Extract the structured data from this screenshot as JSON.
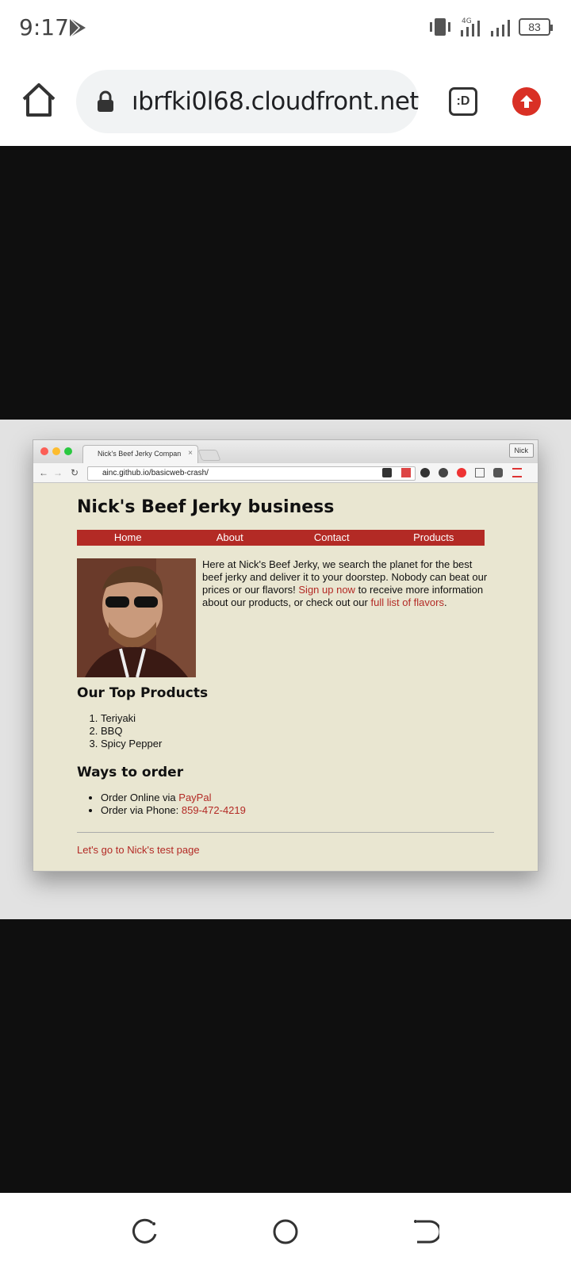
{
  "status_bar": {
    "time": "9:17",
    "battery": "83",
    "network": "4G",
    "icons": [
      "play-store-icon",
      "vibrate-icon",
      "signal-icon",
      "wifi-icon",
      "battery-icon"
    ]
  },
  "browser": {
    "url": "ıbrfki0l68.cloudfront.net",
    "tab_switcher_label": ":D",
    "colors": {
      "upload_button": "#d93025"
    }
  },
  "screenshot": {
    "tab_title": "Nick's Beef Jerky Compan",
    "user_button": "Nick",
    "url": "ainc.github.io/basicweb-crash/",
    "site": {
      "title": "Nick's Beef Jerky business",
      "nav": [
        "Home",
        "About",
        "Contact",
        "Products"
      ],
      "intro": {
        "text1": "Here at Nick's Beef Jerky, we search the planet for the best beef jerky and deliver it to your doorstep. Nobody can beat our prices or our flavors!",
        "link1": "Sign up now",
        "text2": "to receive more information about our products, or check out our",
        "link2": "full list of flavors",
        "text3": "."
      },
      "products_heading": "Our Top Products",
      "products": [
        "Teriyaki",
        "BBQ",
        "Spicy Pepper"
      ],
      "order_heading": "Ways to order",
      "order_online": "Order Online via",
      "order_online_link": "PayPal",
      "order_phone": "Order via Phone:",
      "order_phone_link": "859-472-4219",
      "footer_link": "Let's go to Nick's test page"
    },
    "colors": {
      "accent": "#b32a25",
      "page_bg": "#e9e6d1"
    }
  }
}
